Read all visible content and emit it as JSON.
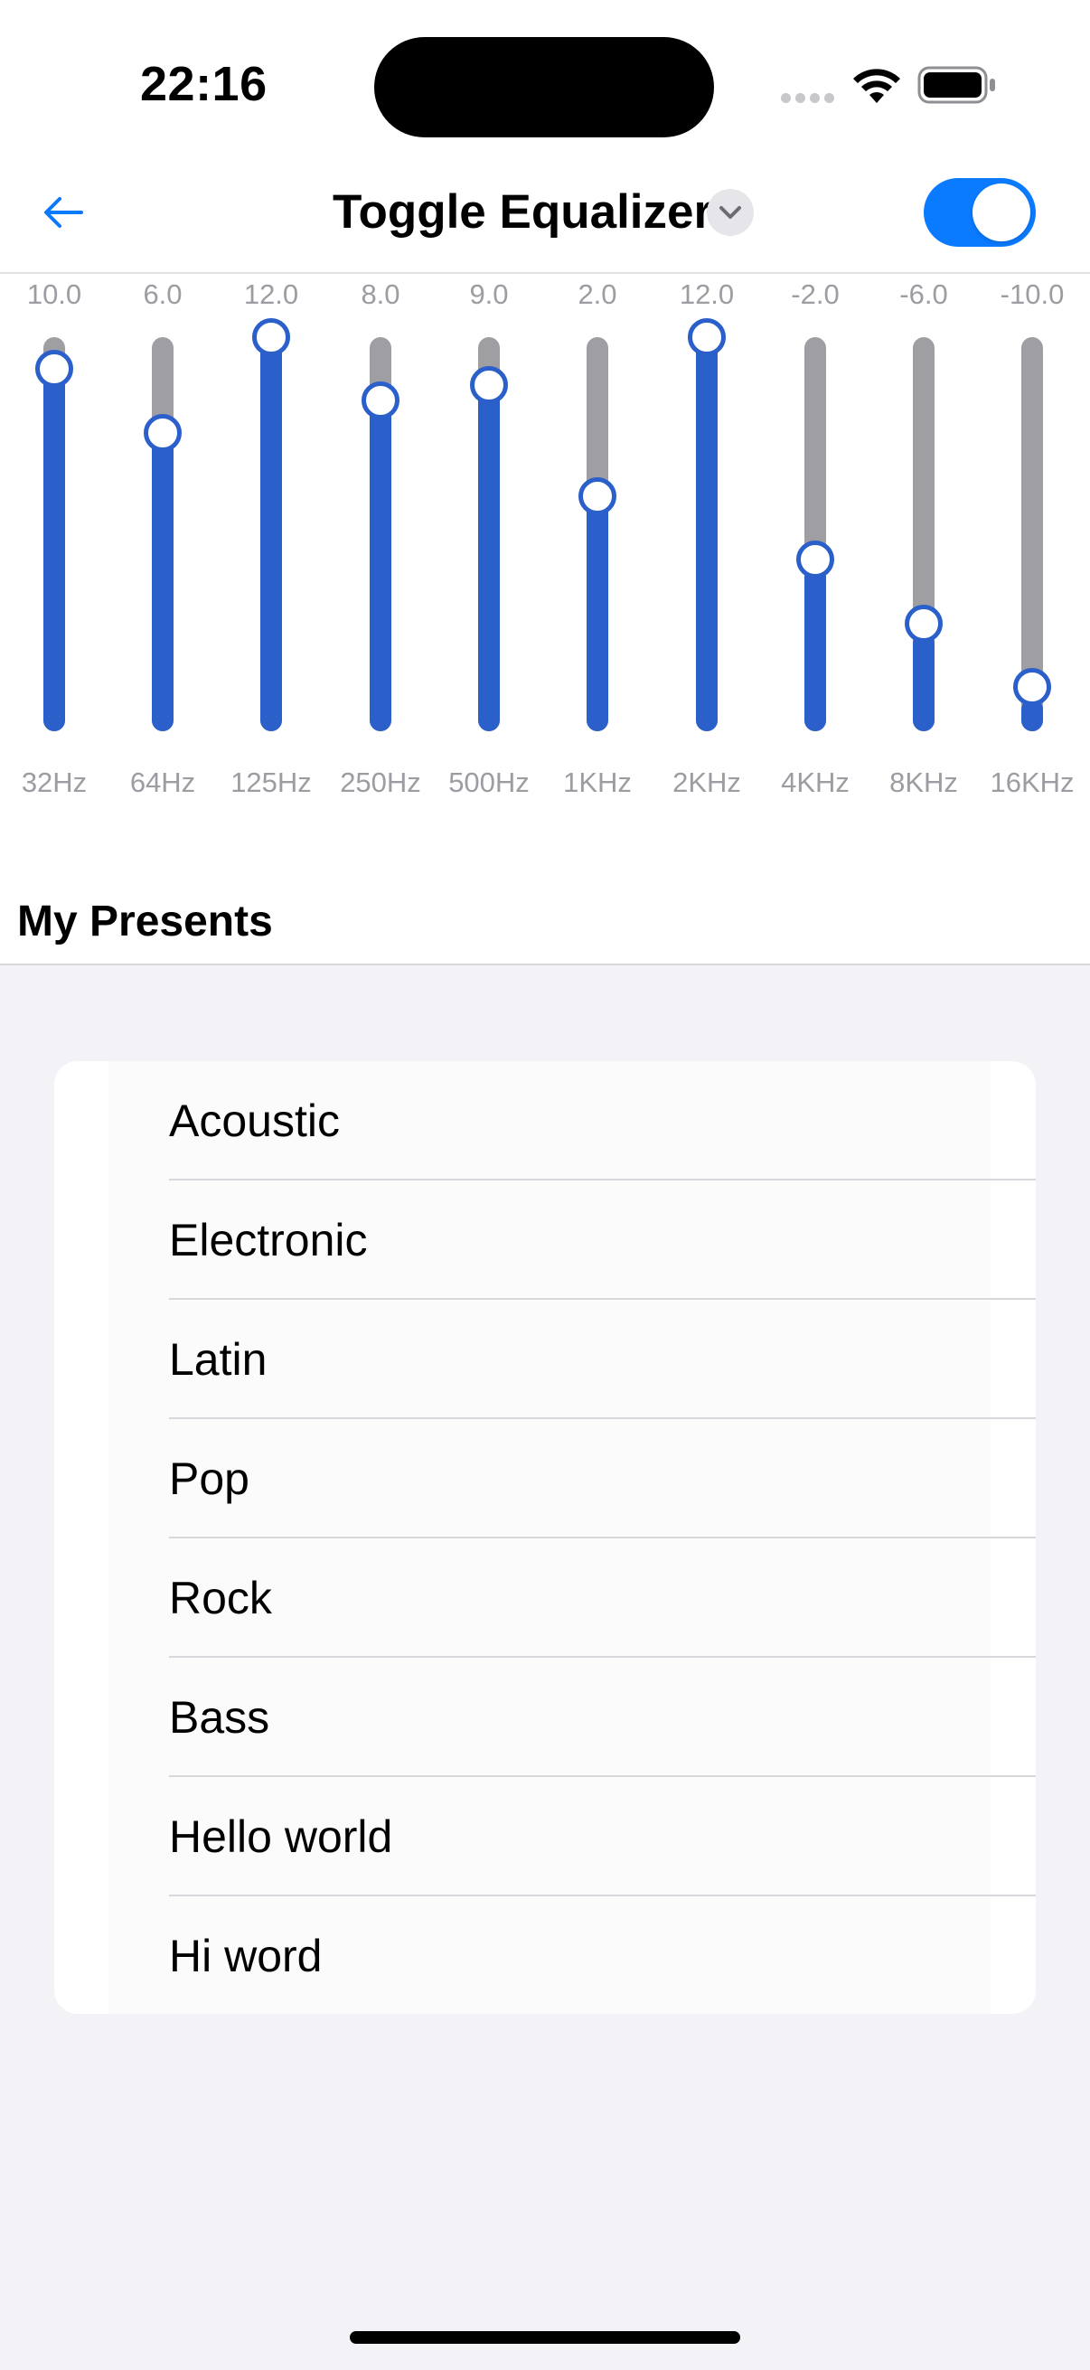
{
  "status_bar": {
    "time": "22:16"
  },
  "nav": {
    "title": "Toggle Equalizer",
    "back_icon": "arrow-left-icon",
    "dropdown_icon": "chevron-down-icon",
    "toggle_on": true
  },
  "colors": {
    "accent": "#0a7aff",
    "slider_fill": "#2b5fca",
    "slider_track": "#9e9ea3",
    "label_gray": "#9c9ca2"
  },
  "equalizer": {
    "min": -12,
    "max": 12,
    "bands": [
      {
        "freq": "32Hz",
        "value_label": "10.0",
        "value": 10
      },
      {
        "freq": "64Hz",
        "value_label": "6.0",
        "value": 6
      },
      {
        "freq": "125Hz",
        "value_label": "12.0",
        "value": 12
      },
      {
        "freq": "250Hz",
        "value_label": "8.0",
        "value": 8
      },
      {
        "freq": "500Hz",
        "value_label": "9.0",
        "value": 9
      },
      {
        "freq": "1KHz",
        "value_label": "2.0",
        "value": 2
      },
      {
        "freq": "2KHz",
        "value_label": "12.0",
        "value": 12
      },
      {
        "freq": "4KHz",
        "value_label": "-2.0",
        "value": -2
      },
      {
        "freq": "8KHz",
        "value_label": "-6.0",
        "value": -6
      },
      {
        "freq": "16KHz",
        "value_label": "-10.0",
        "value": -10
      }
    ]
  },
  "presets": {
    "title": "My Presents",
    "items": [
      "Acoustic",
      "Electronic",
      "Latin",
      "Pop",
      "Rock",
      "Bass",
      "Hello world",
      "Hi word"
    ]
  }
}
